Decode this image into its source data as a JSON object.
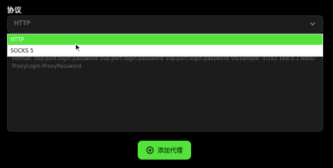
{
  "protocol": {
    "label": "协议",
    "selected": "HTTP",
    "options": [
      "HTTP",
      "SOCKS 5"
    ]
  },
  "proxy_input": {
    "placeholder": "Format: \\nip:port:login:password \\nip:port:login:password \\nip:port:login:password \\nExample: \\n192.168.0.1:8000:ProxyLogin:ProxyPassword"
  },
  "actions": {
    "add_proxy_label": "添加代理"
  },
  "icons": {
    "select_chevron": "chevron-down-icon",
    "add_button_icon": "plus-circle-icon",
    "mouse_cursor": "cursor-arrow-icon"
  },
  "colors": {
    "accent": "#54e33c",
    "background": "#000000",
    "field_background": "#1c1c1c"
  }
}
